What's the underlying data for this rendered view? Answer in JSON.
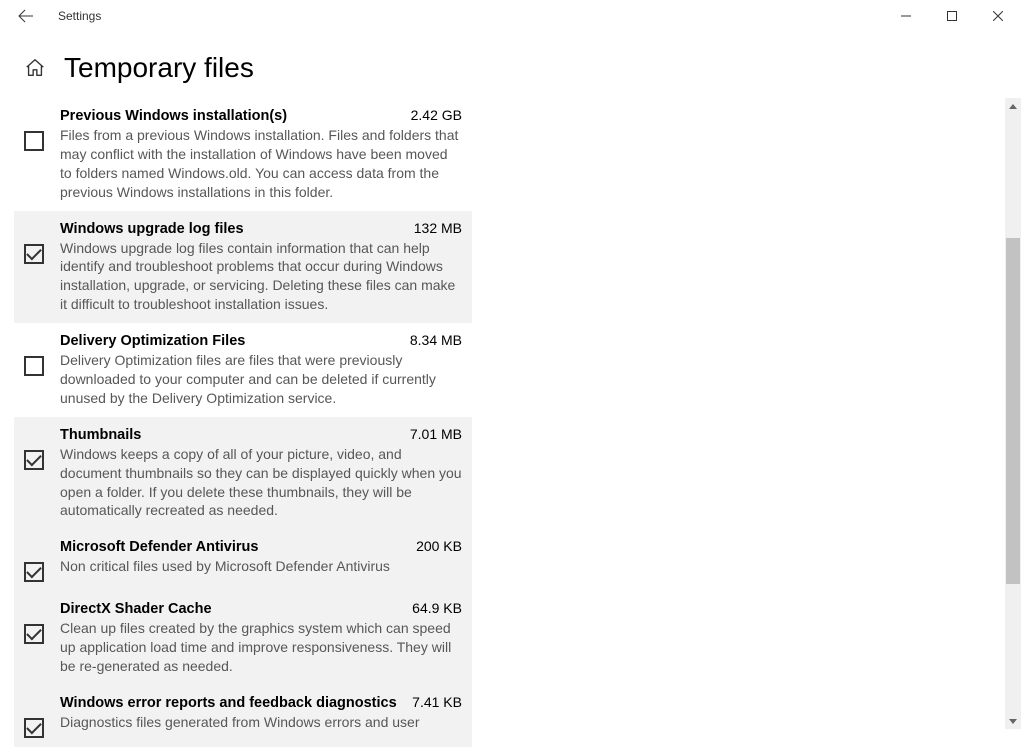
{
  "window": {
    "title": "Settings"
  },
  "page": {
    "title": "Temporary files"
  },
  "items": [
    {
      "title": "Previous Windows installation(s)",
      "size": "2.42 GB",
      "desc": "Files from a previous Windows installation.  Files and folders that may conflict with the installation of Windows have been moved to folders named Windows.old.  You can access data from the previous Windows installations in this folder.",
      "checked": false,
      "highlight": false
    },
    {
      "title": "Windows upgrade log files",
      "size": "132 MB",
      "desc": "Windows upgrade log files contain information that can help identify and troubleshoot problems that occur during Windows installation, upgrade, or servicing.  Deleting these files can make it difficult to troubleshoot installation issues.",
      "checked": true,
      "highlight": true
    },
    {
      "title": "Delivery Optimization Files",
      "size": "8.34 MB",
      "desc": "Delivery Optimization files are files that were previously downloaded to your computer and can be deleted if currently unused by the Delivery Optimization service.",
      "checked": false,
      "highlight": false
    },
    {
      "title": "Thumbnails",
      "size": "7.01 MB",
      "desc": "Windows keeps a copy of all of your picture, video, and document thumbnails so they can be displayed quickly when you open a folder. If you delete these thumbnails, they will be automatically recreated as needed.",
      "checked": true,
      "highlight": true
    },
    {
      "title": "Microsoft Defender Antivirus",
      "size": "200 KB",
      "desc": "Non critical files used by Microsoft Defender Antivirus",
      "checked": true,
      "highlight": true
    },
    {
      "title": "DirectX Shader Cache",
      "size": "64.9 KB",
      "desc": "Clean up files created by the graphics system which can speed up application load time and improve responsiveness. They will be re-generated as needed.",
      "checked": true,
      "highlight": true
    },
    {
      "title": "Windows error reports and feedback diagnostics",
      "size": "7.41 KB",
      "desc": "Diagnostics files generated from Windows errors and user",
      "checked": true,
      "highlight": true
    }
  ],
  "scroll": {
    "thumbTop": 140,
    "thumbHeight": 346
  }
}
